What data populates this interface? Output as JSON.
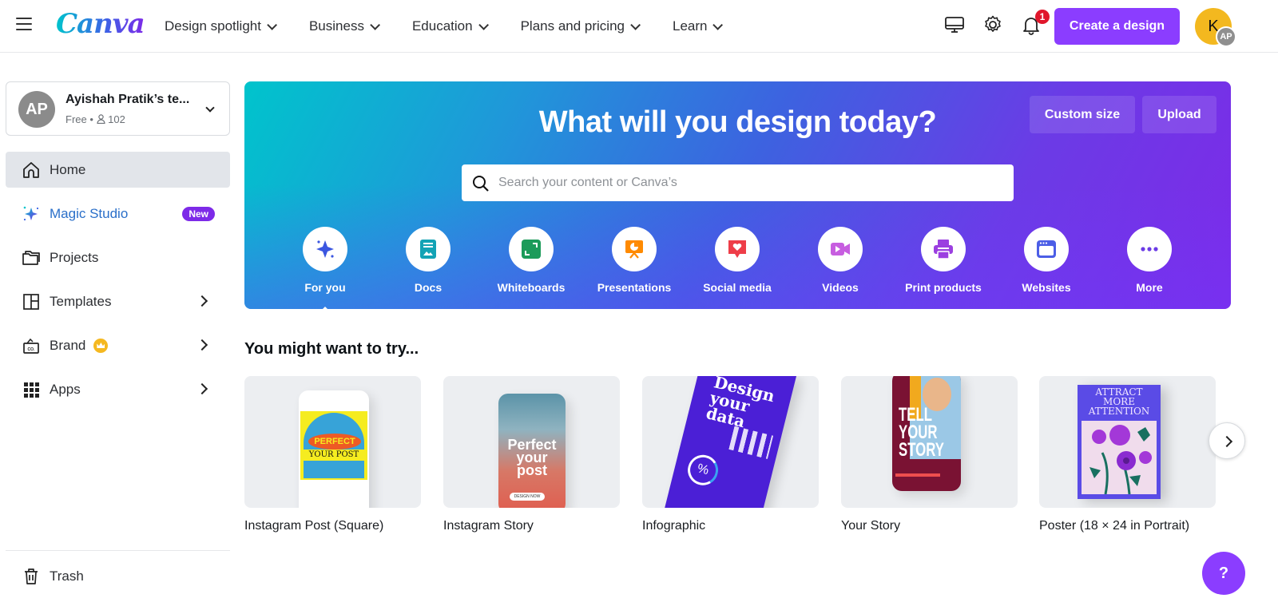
{
  "topbar": {
    "logo": "Canva",
    "nav": [
      {
        "label": "Design spotlight"
      },
      {
        "label": "Business"
      },
      {
        "label": "Education"
      },
      {
        "label": "Plans and pricing"
      },
      {
        "label": "Learn"
      }
    ],
    "notification_count": "1",
    "create_button": "Create a design",
    "avatar_initial": "K",
    "avatar_sub": "AP"
  },
  "sidebar": {
    "team": {
      "avatar": "AP",
      "name": "Ayishah Pratik’s te...",
      "plan": "Free",
      "members": "102"
    },
    "items": [
      {
        "label": "Home",
        "icon": "home-icon",
        "active": true
      },
      {
        "label": "Magic Studio",
        "icon": "sparkle-icon",
        "badge": "New"
      },
      {
        "label": "Projects",
        "icon": "folder-icon"
      },
      {
        "label": "Templates",
        "icon": "templates-icon"
      },
      {
        "label": "Brand",
        "icon": "brand-icon"
      },
      {
        "label": "Apps",
        "icon": "apps-grid-icon"
      }
    ],
    "trash": "Trash"
  },
  "hero": {
    "title": "What will you design today?",
    "custom_size": "Custom size",
    "upload": "Upload",
    "search_placeholder": "Search your content or Canva’s",
    "categories": [
      {
        "label": "For you",
        "icon": "sparkle-icon",
        "color": "#3b56e0"
      },
      {
        "label": "Docs",
        "icon": "doc-icon",
        "color": "#13a3b5"
      },
      {
        "label": "Whiteboards",
        "icon": "whiteboard-icon",
        "color": "#1c9b5a"
      },
      {
        "label": "Presentations",
        "icon": "presentation-icon",
        "color": "#ff8a00"
      },
      {
        "label": "Social media",
        "icon": "heart-chat-icon",
        "color": "#ee3d48"
      },
      {
        "label": "Videos",
        "icon": "video-camera-icon",
        "color": "#c75ee0"
      },
      {
        "label": "Print products",
        "icon": "printer-icon",
        "color": "#9b3fe0"
      },
      {
        "label": "Websites",
        "icon": "browser-window-icon",
        "color": "#4c5ee6"
      },
      {
        "label": "More",
        "icon": "more-dots-icon",
        "color": "#6b3be6"
      }
    ]
  },
  "suggestions": {
    "title": "You might want to try...",
    "cards": [
      {
        "title": "Instagram Post (Square)",
        "art": [
          "PERFECT",
          "YOUR POST"
        ]
      },
      {
        "title": "Instagram Story",
        "art": [
          "Perfect",
          "your",
          "post",
          "DESIGN NOW"
        ]
      },
      {
        "title": "Infographic",
        "art": [
          "Design",
          "your data",
          "%"
        ]
      },
      {
        "title": "Your Story",
        "art": [
          "TELL",
          "YOUR",
          "STORY"
        ]
      },
      {
        "title": "Poster (18 × 24 in Portrait)",
        "art": [
          "ATTRACT",
          "MORE",
          "ATTENTION"
        ]
      }
    ]
  },
  "help": "?"
}
